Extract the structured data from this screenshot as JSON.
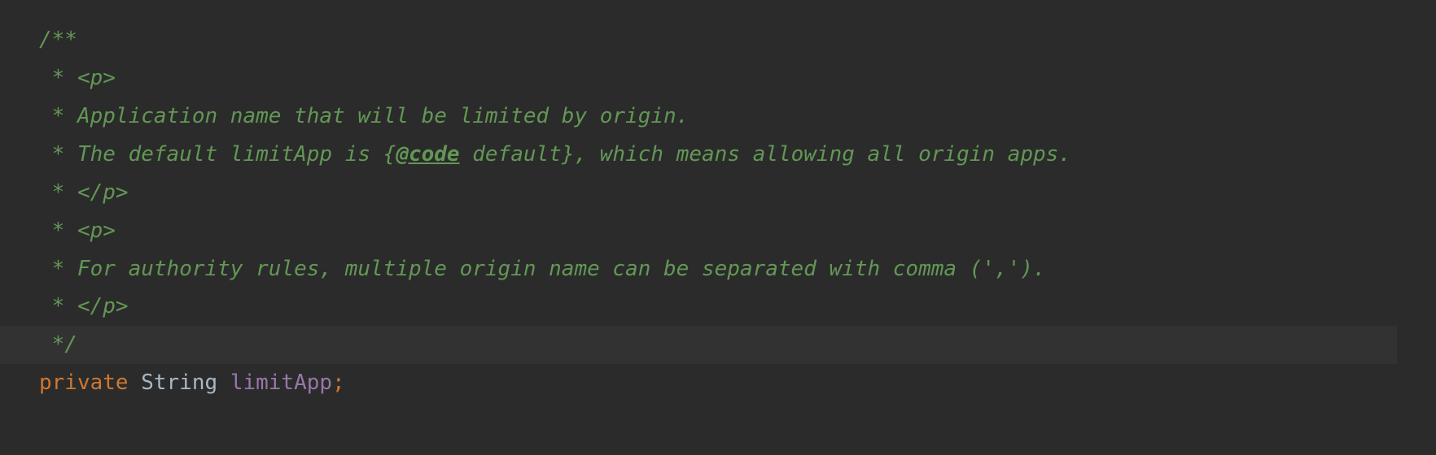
{
  "code": {
    "lines": [
      {
        "text": "/**",
        "class": "javadoc"
      },
      {
        "prefix": " * ",
        "tag": "<p>",
        "class": "javadoc"
      },
      {
        "prefix": " * ",
        "text": "Application name that will be limited by origin.",
        "class": "javadoc"
      },
      {
        "prefix": " * ",
        "before": "The default limitApp is {",
        "tag": "@code",
        "after": " default}, which means allowing all origin apps.",
        "class": "javadoc"
      },
      {
        "prefix": " * ",
        "tag": "</p>",
        "class": "javadoc"
      },
      {
        "prefix": " * ",
        "tag": "<p>",
        "class": "javadoc"
      },
      {
        "prefix": " * ",
        "text": "For authority rules, multiple origin name can be separated with comma (',').",
        "class": "javadoc"
      },
      {
        "prefix": " * ",
        "tag": "</p>",
        "class": "javadoc"
      },
      {
        "text": " */",
        "class": "javadoc",
        "highlighted": true
      },
      {
        "keyword": "private",
        "type": "String",
        "identifier": "limitApp",
        "semicolon": ";"
      }
    ]
  },
  "colors": {
    "background": "#2b2b2b",
    "javadoc": "#629755",
    "keyword": "#cc7832",
    "identifier": "#9876aa",
    "foreground": "#a9b7c6",
    "highlight": "#323232"
  }
}
